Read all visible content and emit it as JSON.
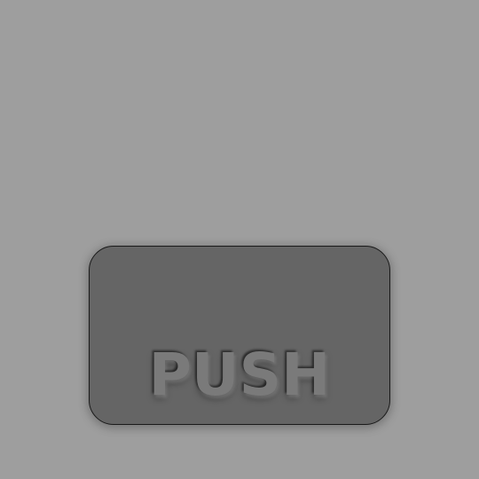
{
  "button": {
    "label": "PUSH"
  },
  "colors": {
    "background": "#9e9e9e",
    "button_fill": "#656565",
    "button_border": "#1a1a1a",
    "label_text": "#7a7a7a"
  }
}
